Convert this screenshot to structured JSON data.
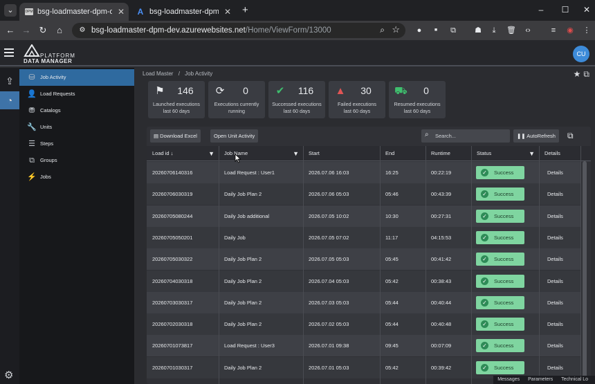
{
  "browser": {
    "tabs": [
      {
        "title": "bsg-loadmaster-dpm-dev.azurewebsites.net",
        "favicon": "DPM",
        "active": true
      },
      {
        "title": "bsg-loadmaster-dpm-dev - Microsoft Azure",
        "favicon": "A",
        "active": false
      }
    ],
    "url_host": "bsg-loadmaster-dpm-dev.azurewebsites.net",
    "url_path": "/Home/ViewForm/13000"
  },
  "app": {
    "logo_line1": "PLATFORM",
    "logo_line2": "DATA MANAGER",
    "user_initials": "CU",
    "breadcrumb": [
      "Load Master",
      "/",
      "Job Activity"
    ],
    "sidebar": [
      {
        "label": "Job Activity",
        "icon": "job-activity-icon",
        "selected": true
      },
      {
        "label": "Load Requests",
        "icon": "load-requests-icon"
      },
      {
        "label": "Catalogs",
        "icon": "catalogs-icon"
      },
      {
        "label": "Units",
        "icon": "units-icon"
      },
      {
        "label": "Steps",
        "icon": "steps-icon"
      },
      {
        "label": "Groups",
        "icon": "groups-icon"
      },
      {
        "label": "Jobs",
        "icon": "jobs-icon"
      }
    ],
    "kpis": [
      {
        "value": "146",
        "line1": "Launched executions",
        "line2": "last 60 days",
        "icon": "checkered-flag-icon",
        "color": "#e8eaed"
      },
      {
        "value": "0",
        "line1": "Executions currently",
        "line2": "running",
        "icon": "refresh-icon",
        "color": "#e8eaed"
      },
      {
        "value": "116",
        "line1": "Successed executions",
        "line2": "last 60 days",
        "icon": "check-circle-icon",
        "color": "#3fbf6e"
      },
      {
        "value": "30",
        "line1": "Failed executions",
        "line2": "last 60 days",
        "icon": "warning-icon",
        "color": "#e05555"
      },
      {
        "value": "0",
        "line1": "Resumed executions",
        "line2": "last 60 days",
        "icon": "truck-icon",
        "color": "#3fbf6e"
      }
    ],
    "toolbar": {
      "download_label": "Download Excel",
      "open_unit_label": "Open Unit Activity",
      "search_placeholder": "Search...",
      "autorefresh_label": "AutoRefresh"
    },
    "columns": [
      "Load id ↓",
      "Job Name",
      "Start",
      "End",
      "Runtime",
      "Status",
      "Details"
    ],
    "rows": [
      {
        "load_id": "20260706140316",
        "job_name": "Load Request : User1",
        "start": "2026.07.06 16:03",
        "end": "16:25",
        "runtime": "00:22:19",
        "status": "Success",
        "details": "Details"
      },
      {
        "load_id": "20260706030319",
        "job_name": "Daily Job Plan 2",
        "start": "2026.07.06 05:03",
        "end": "05:46",
        "runtime": "00:43:39",
        "status": "Success",
        "details": "Details"
      },
      {
        "load_id": "20260705080244",
        "job_name": "Daily Job additional",
        "start": "2026.07.05 10:02",
        "end": "10:30",
        "runtime": "00:27:31",
        "status": "Success",
        "details": "Details"
      },
      {
        "load_id": "20260705050201",
        "job_name": "Daily Job",
        "start": "2026.07.05 07:02",
        "end": "11:17",
        "runtime": "04:15:53",
        "status": "Success",
        "details": "Details"
      },
      {
        "load_id": "20260705030322",
        "job_name": "Daily Job Plan 2",
        "start": "2026.07.05 05:03",
        "end": "05:45",
        "runtime": "00:41:42",
        "status": "Success",
        "details": "Details"
      },
      {
        "load_id": "20260704030318",
        "job_name": "Daily Job Plan 2",
        "start": "2026.07.04 05:03",
        "end": "05:42",
        "runtime": "00:38:43",
        "status": "Success",
        "details": "Details"
      },
      {
        "load_id": "20260703030317",
        "job_name": "Daily Job Plan 2",
        "start": "2026.07.03 05:03",
        "end": "05:44",
        "runtime": "00:40:44",
        "status": "Success",
        "details": "Details"
      },
      {
        "load_id": "20260702030318",
        "job_name": "Daily Job Plan 2",
        "start": "2026.07.02 05:03",
        "end": "05:44",
        "runtime": "00:40:48",
        "status": "Success",
        "details": "Details"
      },
      {
        "load_id": "20260701073817",
        "job_name": "Load Request : User3",
        "start": "2026.07.01 09:38",
        "end": "09:45",
        "runtime": "00:07:09",
        "status": "Success",
        "details": "Details"
      },
      {
        "load_id": "20260701030317",
        "job_name": "Daily Job Plan 2",
        "start": "2026.07.01 05:03",
        "end": "05:42",
        "runtime": "00:39:42",
        "status": "Success",
        "details": "Details"
      }
    ],
    "statusbar": [
      "Messages",
      "Parameters",
      "Technical Lo"
    ]
  }
}
